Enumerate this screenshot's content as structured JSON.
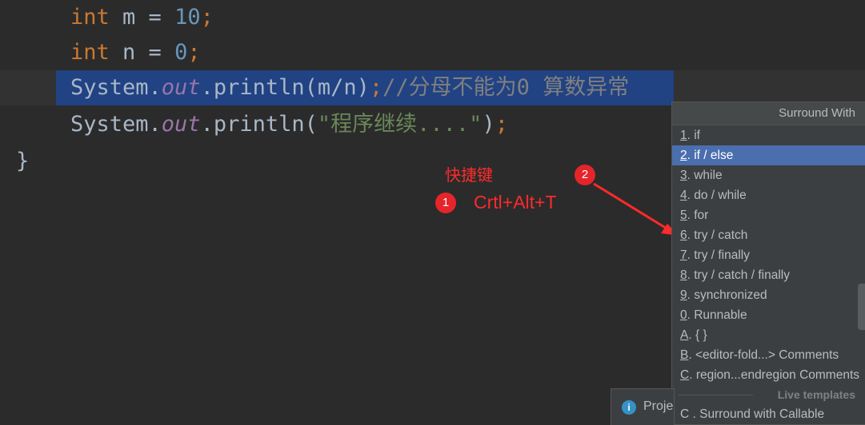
{
  "editor": {
    "line1": {
      "kw": "int",
      "rest": " m = ",
      "num": "10",
      "end": ";"
    },
    "line2": {
      "kw": "int",
      "rest": " n = ",
      "num": "0",
      "end": ";"
    },
    "line3": {
      "a": "System.",
      "field": "out",
      "b": ".println(m/n)",
      "semi": ";",
      "comment": "//分母不能为0 算数异常"
    },
    "line4": {
      "a": "System.",
      "field": "out",
      "b": ".println(",
      "str": "\"程序继续....\"",
      "c": ")",
      "semi": ";"
    },
    "line5": {
      "brace": "}"
    }
  },
  "annotations": {
    "shortcut_title": "快捷键",
    "shortcut_keys": "Crtl+Alt+T",
    "badge1": "1",
    "badge2": "2",
    "color": "#ff2a2a"
  },
  "popup": {
    "title": "Surround With",
    "items": [
      {
        "key": "1",
        "label": ". if"
      },
      {
        "key": "2",
        "label": ". if / else",
        "selected": true
      },
      {
        "key": "3",
        "label": ". while"
      },
      {
        "key": "4",
        "label": ". do / while"
      },
      {
        "key": "5",
        "label": ". for"
      },
      {
        "key": "6",
        "label": ". try / catch"
      },
      {
        "key": "7",
        "label": ". try / finally"
      },
      {
        "key": "8",
        "label": ". try / catch / finally"
      },
      {
        "key": "9",
        "label": ". synchronized"
      },
      {
        "key": "0",
        "label": ". Runnable"
      },
      {
        "key": "A",
        "label": ". { }"
      },
      {
        "key": "B",
        "label": ". <editor-fold...> Comments"
      },
      {
        "key": "C",
        "label": ". region...endregion Comments"
      }
    ],
    "section": "Live templates",
    "live_item": "C . Surround with Callable"
  },
  "notification": {
    "text": "Proje",
    "icon": "info-icon"
  }
}
